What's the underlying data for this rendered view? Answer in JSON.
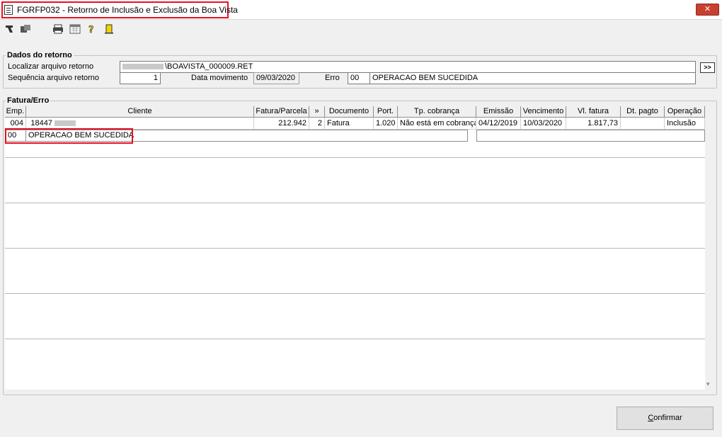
{
  "window": {
    "title": "FGRFP032 - Retorno de Inclusão e Exclusão da Boa Vista",
    "close_label": "✕"
  },
  "toolbar": {
    "icons": [
      "arrow-icon",
      "export-icon",
      "printer-icon",
      "calendar-icon",
      "help-icon",
      "exit-door-icon"
    ]
  },
  "dados": {
    "legend": "Dados do retorno",
    "localizar_label": "Localizar arquivo retorno",
    "localizar_value": "\\BOAVISTA_000009.RET",
    "sequencia_label": "Sequência arquivo retorno",
    "sequencia_value": "1",
    "data_label": "Data movimento",
    "data_value": "09/03/2020",
    "erro_label": "Erro",
    "erro_code": "00",
    "erro_desc": "OPERACAO BEM SUCEDIDA",
    "browse_label": ">>"
  },
  "fatura": {
    "legend": "Fatura/Erro",
    "columns": [
      "Emp.",
      "Cliente",
      "Fatura/Parcela",
      "»",
      "Documento",
      "Port.",
      "Tp. cobrança",
      "Emissão",
      "Vencimento",
      "Vl. fatura",
      "Dt. pagto",
      "Operação"
    ],
    "row": {
      "emp": "004",
      "cliente_code": "18447",
      "fatura": "212.942",
      "parcela": "2",
      "documento": "Fatura",
      "port": "1.020",
      "tp_cobranca": "Não está em cobrança",
      "emissao": "04/12/2019",
      "vencimento": "10/03/2020",
      "vl_fatura": "1.817,73",
      "dt_pagto": "",
      "operacao": "Inclusão"
    },
    "error_row": {
      "code": "00",
      "desc": "OPERACAO BEM SUCEDIDA"
    }
  },
  "footer": {
    "confirm_label": "onfirmar",
    "confirm_accel": "C"
  },
  "colors": {
    "highlight": "#e81123",
    "close": "#c8402e"
  }
}
